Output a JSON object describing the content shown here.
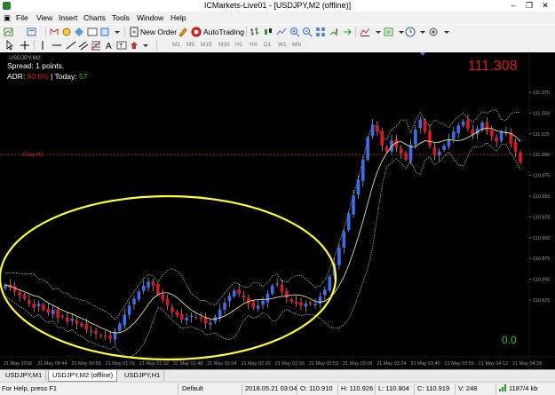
{
  "window": {
    "title": "ICMarkets-Live01 - [USDJPY,M2 (offline)]",
    "minimize": "–",
    "restore": "❐",
    "close": "✕"
  },
  "menu": [
    "File",
    "View",
    "Insert",
    "Charts",
    "Tools",
    "Window",
    "Help"
  ],
  "toolbar": {
    "new_order": "New Order",
    "autotrading": "AutoTrading"
  },
  "timeframes": [
    "M1",
    "M5",
    "M15",
    "M30",
    "H1",
    "H4",
    "D1",
    "W1",
    "MN"
  ],
  "chart": {
    "symbol_header": "USDJPY,M2",
    "spread": "Spread: 1 points.",
    "adr_label": "ADR: ",
    "adr_value": "93.6%",
    "today_label": " |  Today: ",
    "today_value": "57",
    "big_price": "111.308",
    "bottom_value": "0.0",
    "daily_label": "Daily R1",
    "colors": {
      "bull": "#3a6df0",
      "bear": "#e0161a",
      "ma": "#fff3a6",
      "band": "#ffffff",
      "ellipse": "#ffff2e",
      "daily": "#c8282c",
      "big_price": "#e0161a",
      "bottom_value": "#22cc22"
    },
    "price_labels": [
      "111.075",
      "111.050",
      "111.025",
      "111.000",
      "110.975",
      "110.950",
      "110.925",
      "110.900",
      "110.875",
      "110.850",
      "110.825"
    ],
    "time_labels": [
      "21 May 2018",
      "21 May 00:44",
      "21 May 00:58",
      "21 May 01:16",
      "21 May 01:32",
      "21 May 01:48",
      "21 May 02:04",
      "21 May 02:20",
      "21 May 02:36",
      "21 May 02:52",
      "21 May 03:08",
      "21 May 03:24",
      "21 May 03:40",
      "21 May 03:56",
      "21 May 04:12",
      "21 May 04:28"
    ]
  },
  "chart_data": {
    "type": "candlestick",
    "title": "USDJPY,M2",
    "overlays": [
      "moving average",
      "envelope bands",
      "Daily R1 level"
    ],
    "ylim": [
      110.82,
      111.11
    ],
    "daily_r1": 111.015,
    "close_series": [
      110.885,
      110.882,
      110.878,
      110.874,
      110.871,
      110.866,
      110.862,
      110.866,
      110.86,
      110.857,
      110.86,
      110.852,
      110.853,
      110.848,
      110.851,
      110.846,
      110.844,
      110.84,
      110.838,
      110.836,
      110.834,
      110.833,
      110.831,
      110.838,
      110.846,
      110.855,
      110.864,
      110.871,
      110.878,
      110.884,
      110.888,
      110.884,
      110.876,
      110.87,
      110.864,
      110.858,
      110.854,
      110.85,
      110.852,
      110.854,
      110.852,
      110.851,
      110.846,
      110.847,
      110.853,
      110.86,
      110.867,
      110.874,
      110.879,
      110.876,
      110.872,
      110.866,
      110.862,
      110.864,
      110.869,
      110.876,
      110.884,
      110.886,
      110.878,
      110.872,
      110.868,
      110.866,
      110.864,
      110.866,
      110.866,
      110.866,
      110.873,
      110.88,
      110.893,
      110.906,
      110.922,
      110.938,
      110.956,
      110.974,
      110.99,
      111.01,
      111.032,
      111.045,
      111.038,
      111.024,
      111.018,
      111.029,
      111.022,
      111.016,
      111.01,
      111.025,
      111.04,
      111.05,
      111.038,
      111.024,
      111.014,
      111.018,
      111.024,
      111.03,
      111.038,
      111.044,
      111.048,
      111.041,
      111.035,
      111.041,
      111.047,
      111.038,
      111.033,
      111.028,
      111.038,
      111.037,
      111.026,
      111.018,
      111.007
    ],
    "status": {
      "datetime": "2018.05.21 03:04",
      "open": "110.910",
      "high": "110.926",
      "low": "110.904",
      "close": "110.919",
      "volume": "248"
    }
  },
  "tabs": [
    "USDJPY,M1",
    "USDJPY,M2 (offline)",
    "USDJPY,H1"
  ],
  "status": {
    "help": "For Help, press F1",
    "profile": "Default",
    "datetime": "2018.05.21 03:04",
    "open": "O: 110.910",
    "high": "H: 110.926",
    "low": "L: 110.904",
    "close": "C: 110.919",
    "volume": "V: 248",
    "traffic": "1187/4 kb"
  }
}
